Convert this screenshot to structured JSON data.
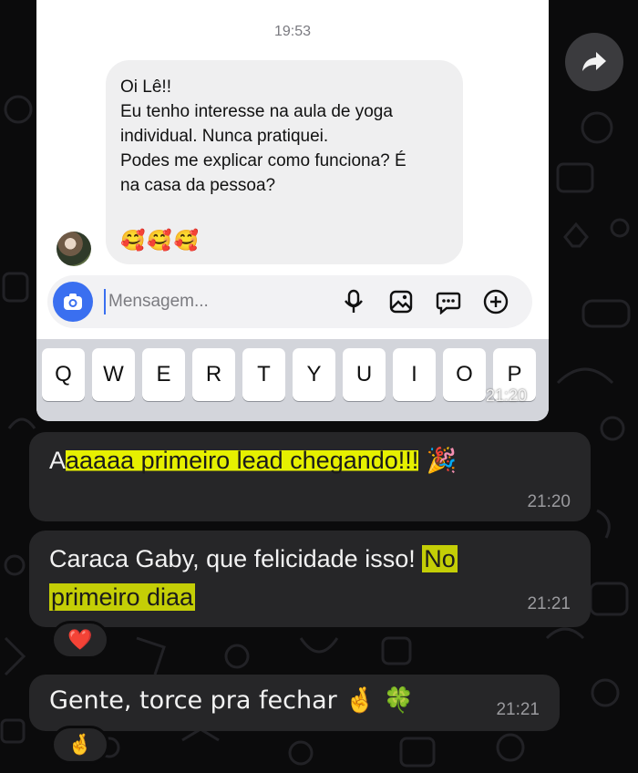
{
  "screenshot": {
    "time": "19:53",
    "dm_lines": [
      "Oi Lê!!",
      "Eu tenho interesse na aula de yoga",
      "individual. Nunca pratiquei.",
      "Podes me explicar como funciona? É",
      "na casa da pessoa?"
    ],
    "dm_emojis": "🥰🥰🥰",
    "composer_placeholder": "Mensagem...",
    "keys": [
      "Q",
      "W",
      "E",
      "R",
      "T",
      "Y",
      "U",
      "I",
      "O",
      "P"
    ],
    "stamp": "21:20"
  },
  "messages": [
    {
      "pre": "A",
      "highlight": "aaaaa primeiro lead chegando!!!",
      "post": " 🎉",
      "time": "21:20"
    },
    {
      "line1_text": "Caraca Gaby, que felicidade isso! ",
      "line1_highlight": "No",
      "line2_highlight": "primeiro diaa",
      "time": "21:21",
      "reaction": "❤️"
    },
    {
      "text": "Gente, torce pra fechar 🤞 🍀",
      "time": "21:21",
      "reaction": "🤞"
    }
  ],
  "colors": {
    "background": "#0b0b0c",
    "bubble": "#262628",
    "highlight": "#e6f000",
    "accent": "#3a6ff0"
  },
  "icons": [
    "forward-arrow-icon",
    "camera-icon",
    "microphone-icon",
    "gallery-icon",
    "sticker-icon",
    "plus-circle-icon"
  ]
}
